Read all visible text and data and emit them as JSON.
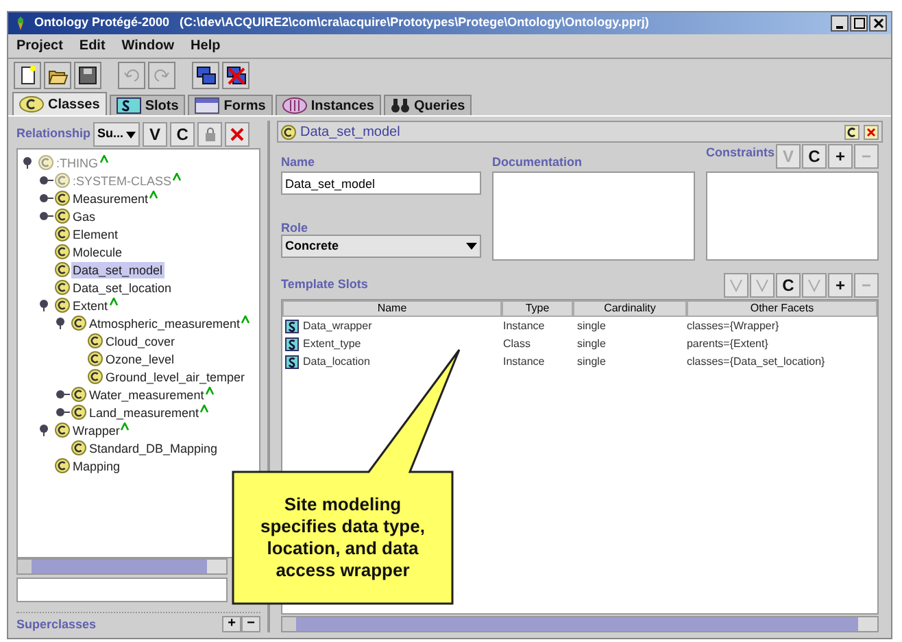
{
  "window": {
    "title": "Ontology Protégé-2000   (C:\\dev\\ACQUIRE2\\com\\cra\\acquire\\Prototypes\\Protege\\Ontology\\Ontology.pprj)"
  },
  "menu": [
    "Project",
    "Edit",
    "Window",
    "Help"
  ],
  "toolbar": [
    {
      "kind": "new",
      "disabled": false
    },
    {
      "kind": "open",
      "disabled": false
    },
    {
      "kind": "save",
      "disabled": false
    },
    {
      "kind": "undo",
      "disabled": true
    },
    {
      "kind": "redo",
      "disabled": true
    },
    {
      "kind": "windows",
      "disabled": false
    },
    {
      "kind": "close-windows",
      "disabled": false
    }
  ],
  "tabs": [
    {
      "label": "Classes",
      "kind": "classes",
      "selected": true
    },
    {
      "label": "Slots",
      "kind": "slots",
      "selected": false
    },
    {
      "label": "Forms",
      "kind": "forms",
      "selected": false
    },
    {
      "label": "Instances",
      "kind": "instances",
      "selected": false
    },
    {
      "label": "Queries",
      "kind": "queries",
      "selected": false
    }
  ],
  "class_panel": {
    "label": "Relationship",
    "dropdown": "Su...",
    "buttons": [
      {
        "label": "V",
        "kind": "text"
      },
      {
        "label": "C",
        "kind": "text"
      },
      {
        "kind": "lock"
      },
      {
        "kind": "delete"
      }
    ],
    "tree": [
      {
        "name": ":THING",
        "kind": "folder",
        "expanded": true,
        "system": true,
        "abstract": true,
        "selected": false,
        "children": [
          {
            "name": ":SYSTEM-CLASS",
            "kind": "folder",
            "expanded": false,
            "system": true,
            "abstract": true,
            "selected": false
          },
          {
            "name": "Measurement",
            "kind": "folder",
            "expanded": false,
            "system": false,
            "abstract": true,
            "selected": false
          },
          {
            "name": "Gas",
            "kind": "folder",
            "expanded": false,
            "system": false,
            "abstract": false,
            "selected": false
          },
          {
            "name": "Element",
            "kind": "leaf",
            "system": false,
            "abstract": false,
            "selected": false
          },
          {
            "name": "Molecule",
            "kind": "leaf",
            "system": false,
            "abstract": false,
            "selected": false
          },
          {
            "name": "Data_set_model",
            "kind": "leaf",
            "system": false,
            "abstract": false,
            "selected": true
          },
          {
            "name": "Data_set_location",
            "kind": "leaf",
            "system": false,
            "abstract": false,
            "selected": false
          },
          {
            "name": "Extent",
            "kind": "folder",
            "expanded": true,
            "system": false,
            "abstract": true,
            "selected": false,
            "children": [
              {
                "name": "Atmospheric_measurement",
                "kind": "folder",
                "expanded": true,
                "system": false,
                "abstract": true,
                "selected": false,
                "children": [
                  {
                    "name": "Cloud_cover",
                    "kind": "leaf",
                    "system": false,
                    "abstract": false,
                    "selected": false
                  },
                  {
                    "name": "Ozone_level",
                    "kind": "leaf",
                    "system": false,
                    "abstract": false,
                    "selected": false
                  },
                  {
                    "name": "Ground_level_air_temper",
                    "kind": "leaf",
                    "system": false,
                    "abstract": false,
                    "selected": false
                  }
                ]
              },
              {
                "name": "Water_measurement",
                "kind": "folder",
                "expanded": false,
                "system": false,
                "abstract": true,
                "selected": false
              },
              {
                "name": "Land_measurement",
                "kind": "folder",
                "expanded": false,
                "system": false,
                "abstract": true,
                "selected": false
              }
            ]
          },
          {
            "name": "Wrapper",
            "kind": "folder",
            "expanded": true,
            "system": false,
            "abstract": true,
            "selected": false,
            "children": [
              {
                "name": "Standard_DB_Mapping",
                "kind": "leaf",
                "system": false,
                "abstract": false,
                "selected": false
              }
            ]
          },
          {
            "name": "Mapping",
            "kind": "leaf",
            "system": false,
            "abstract": false,
            "selected": false
          }
        ]
      }
    ],
    "superclasses": {
      "label": "Superclasses",
      "buttons": [
        "+",
        "−"
      ]
    }
  },
  "class_form": {
    "title": "Data_set_model",
    "name_label": "Name",
    "name_value": "Data_set_model",
    "role_label": "Role",
    "role_value": "Concrete",
    "documentation_label": "Documentation",
    "constraints_label": "Constraints",
    "constraint_buttons": [
      {
        "label": "V",
        "disabled": true
      },
      {
        "label": "C",
        "disabled": false
      },
      {
        "label": "+",
        "disabled": false
      },
      {
        "label": "−",
        "disabled": true
      }
    ],
    "slots_label": "Template Slots",
    "slot_buttons": [
      {
        "kind": "icon",
        "disabled": true
      },
      {
        "kind": "icon",
        "disabled": true
      },
      {
        "kind": "text",
        "label": "C",
        "disabled": false
      },
      {
        "kind": "icon",
        "disabled": true
      },
      {
        "kind": "text",
        "label": "+",
        "disabled": false
      },
      {
        "kind": "text",
        "label": "−",
        "disabled": true
      }
    ],
    "table": {
      "columns": [
        "Name",
        "Type",
        "Cardinality",
        "Other Facets"
      ],
      "rows": [
        {
          "name": "Data_wrapper",
          "type": "Instance",
          "cardinality": "single",
          "facets": "classes={Wrapper}"
        },
        {
          "name": "Extent_type",
          "type": "Class",
          "cardinality": "single",
          "facets": "parents={Extent}"
        },
        {
          "name": "Data_location",
          "type": "Instance",
          "cardinality": "single",
          "facets": "classes={Data_set_location}"
        }
      ]
    }
  },
  "callout": {
    "text": "Site modeling specifies data type, location, and data access wrapper"
  }
}
